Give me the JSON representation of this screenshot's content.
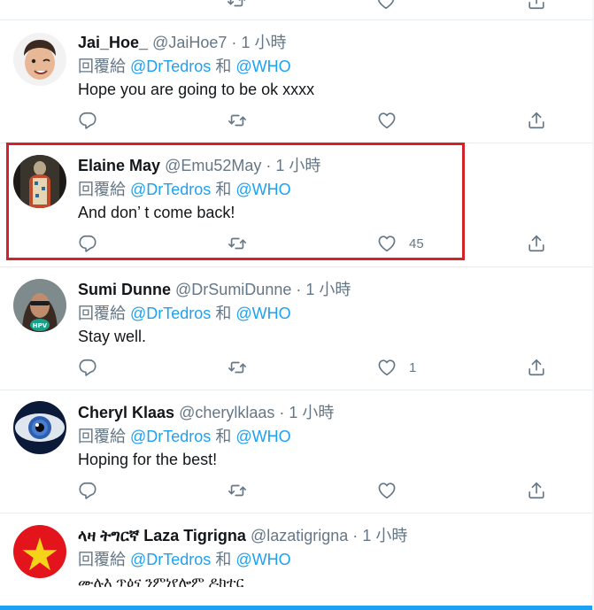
{
  "colors": {
    "mention": "#1da1f2",
    "secondary": "#657786",
    "highlight": "#d2232a"
  },
  "tweets": [
    {
      "display_name": "Jai_Hoe_",
      "handle": "@JaiHoe7",
      "dot": "·",
      "time": "1 小時",
      "reply_prefix": "回覆給",
      "mention1": "@DrTedros",
      "reply_and": "和",
      "mention2": "@WHO",
      "text": "Hope you are going to be ok xxxx",
      "like_count": "",
      "avatar": "memoji-avatar"
    },
    {
      "display_name": "Elaine May",
      "handle": "@Emu52May",
      "dot": "·",
      "time": "1 小時",
      "reply_prefix": "回覆給",
      "mention1": "@DrTedros",
      "reply_and": "和",
      "mention2": "@WHO",
      "text": "And don’ t come back!",
      "like_count": "45",
      "avatar": "figure-avatar"
    },
    {
      "display_name": "Sumi Dunne",
      "handle": "@DrSumiDunne",
      "dot": "·",
      "time": "1 小時",
      "reply_prefix": "回覆給",
      "mention1": "@DrTedros",
      "reply_and": "和",
      "mention2": "@WHO",
      "text": "Stay well.",
      "like_count": "1",
      "avatar": "portrait-avatar",
      "avatar_badge": "HPV"
    },
    {
      "display_name": "Cheryl Klaas",
      "handle": "@cherylklaas",
      "dot": "·",
      "time": "1 小時",
      "reply_prefix": "回覆給",
      "mention1": "@DrTedros",
      "reply_and": "和",
      "mention2": "@WHO",
      "text": "Hoping for the best!",
      "like_count": "",
      "avatar": "eye-avatar"
    },
    {
      "display_name": "ላዛ ትግርኛ Laza Tigrigna",
      "handle": "@lazatigrigna",
      "dot": "·",
      "time": "1 小時",
      "reply_prefix": "回覆給",
      "mention1": "@DrTedros",
      "reply_and": "和",
      "mention2": "@WHO",
      "text": "ሙሉእ ጥዕና ንምነየሎም ዶክተር",
      "like_count": "",
      "avatar": "flag-avatar"
    }
  ],
  "icons": [
    "reply-icon",
    "retweet-icon",
    "like-icon",
    "share-icon"
  ]
}
